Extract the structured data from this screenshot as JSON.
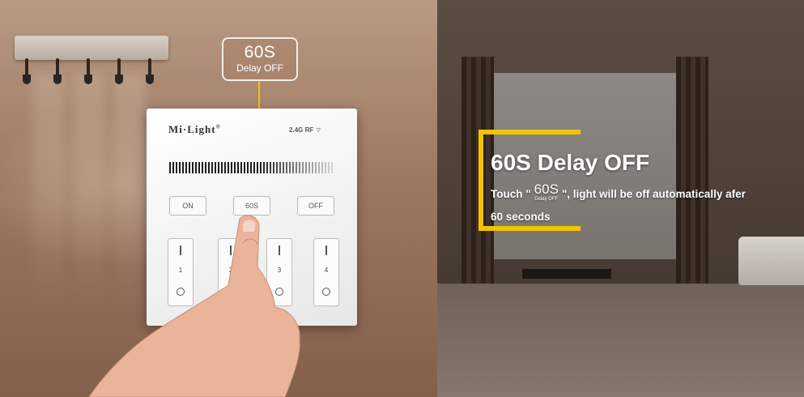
{
  "callout": {
    "big": "60S",
    "small": "Delay OFF"
  },
  "panel": {
    "brand": "Mi·Light",
    "brand_mark": "®",
    "rf_label": "2.4G RF",
    "buttons": {
      "on": "ON",
      "delay": "60S",
      "off": "OFF"
    },
    "zones": [
      "1",
      "2",
      "3",
      "4"
    ]
  },
  "overlay": {
    "title": "60S Delay OFF",
    "desc_prefix": "Touch \"",
    "badge_big": "60S",
    "badge_small": "Delay OFF",
    "desc_suffix": "\", light will be off automatically afer",
    "desc_line2": "60 seconds"
  },
  "colors": {
    "accent": "#f1c400",
    "wall": "#9d7862",
    "room": "#4a3e36"
  }
}
